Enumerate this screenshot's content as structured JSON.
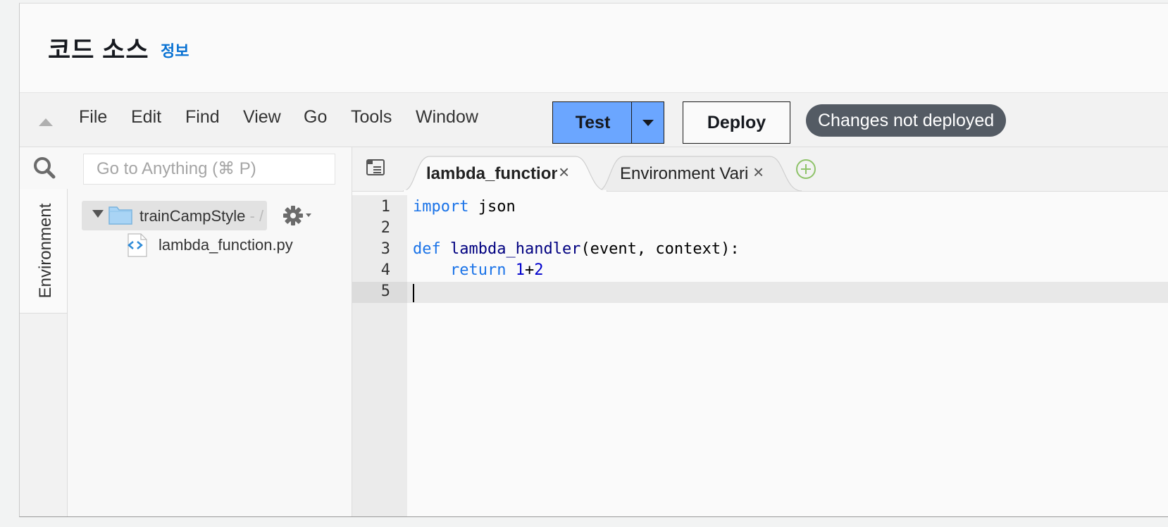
{
  "header": {
    "title": "코드 소스",
    "info_link": "정보"
  },
  "menubar": {
    "items": [
      "File",
      "Edit",
      "Find",
      "View",
      "Go",
      "Tools",
      "Window"
    ],
    "test_label": "Test",
    "deploy_label": "Deploy",
    "status_badge": "Changes not deployed"
  },
  "sidebar": {
    "search_placeholder": "Go to Anything (⌘ P)",
    "env_tab_label": "Environment",
    "tree": {
      "root_label": "trainCampStyle",
      "root_suffix": " - /",
      "files": [
        "lambda_function.py"
      ]
    }
  },
  "editor": {
    "tabs": [
      {
        "label": "lambda_function",
        "active": true
      },
      {
        "label": "Environment Vari",
        "active": false
      }
    ],
    "line_numbers": [
      "1",
      "2",
      "3",
      "4",
      "5"
    ],
    "code": {
      "line1": {
        "kw": "import",
        "rest": " json"
      },
      "line3": {
        "kw": "def",
        "fn": "lambda_handler",
        "rest": "(event, context):"
      },
      "line4": {
        "indent": "    ",
        "kw": "return",
        "num1": "1",
        "op": "+",
        "num2": "2"
      }
    }
  },
  "colors": {
    "test_button": "#6ba6ff",
    "badge": "#545b64",
    "info_link": "#0972d3",
    "keyword": "#1a73e8"
  }
}
